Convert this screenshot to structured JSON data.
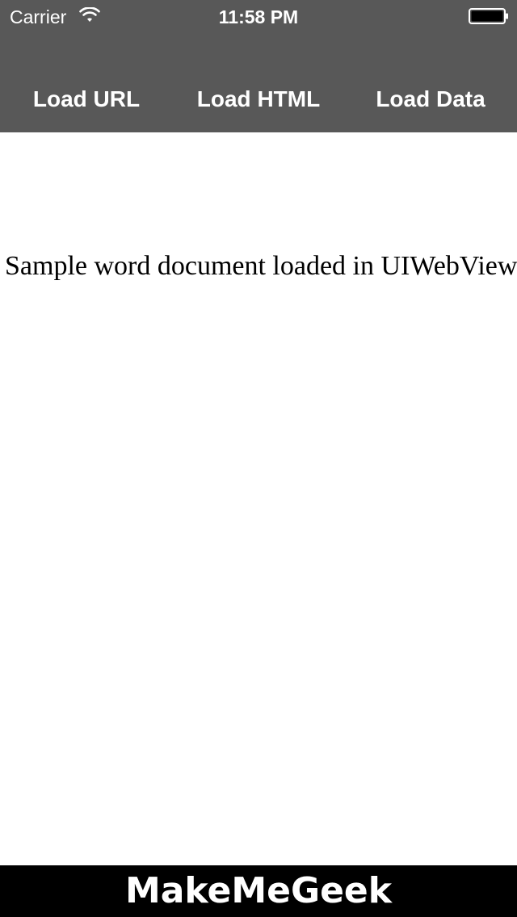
{
  "status_bar": {
    "carrier": "Carrier",
    "time": "11:58 PM",
    "wifi_icon": "wifi-icon",
    "battery_icon": "battery-icon"
  },
  "toolbar": {
    "load_url_label": "Load URL",
    "load_html_label": "Load HTML",
    "load_data_label": "Load Data"
  },
  "webview": {
    "content_text": "Sample word document loaded in UIWebView"
  },
  "banner": {
    "text": "MakeMeGeek"
  },
  "colors": {
    "toolbar_bg": "#585858",
    "banner_bg": "#000000",
    "content_bg": "#ffffff",
    "text_light": "#ffffff"
  }
}
